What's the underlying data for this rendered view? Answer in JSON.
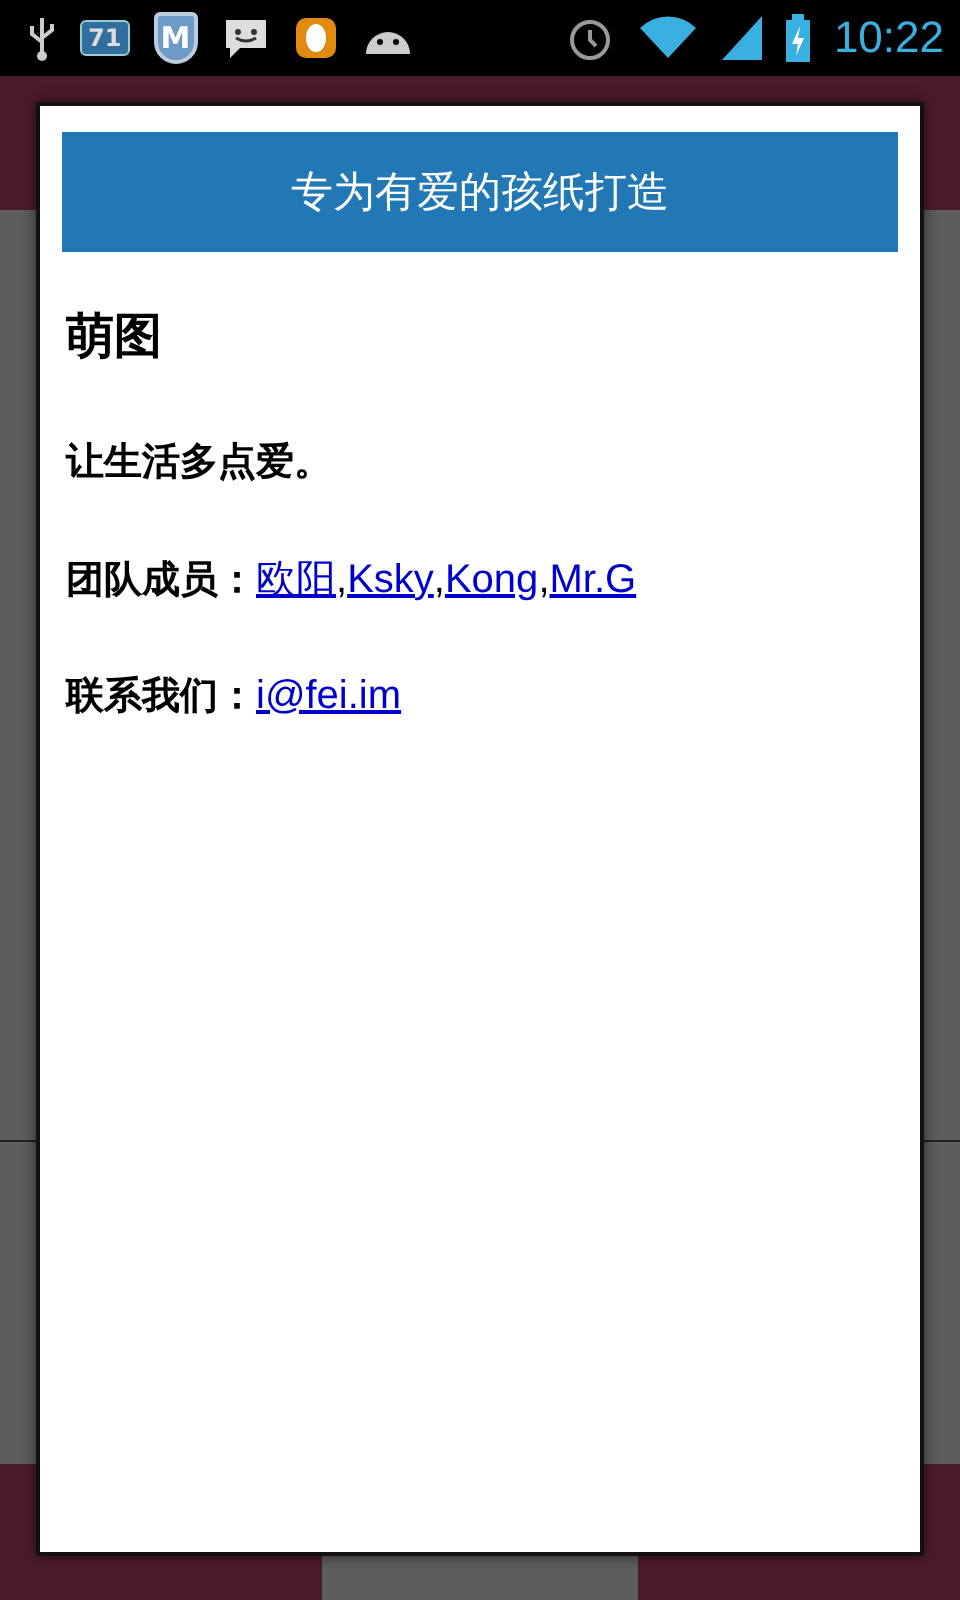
{
  "status_bar": {
    "notification_badge": "71",
    "shield_letter": "M",
    "time": "10:22"
  },
  "dialog": {
    "banner": "专为有爱的孩纸打造",
    "title": "萌图",
    "slogan": "让生活多点爱。",
    "team": {
      "label": "团队成员：",
      "separator": ",",
      "members": [
        "欧阳",
        "Ksky",
        "Kong",
        "Mr.G"
      ]
    },
    "contact": {
      "label": "联系我们：",
      "email": "i@fei.im"
    }
  }
}
